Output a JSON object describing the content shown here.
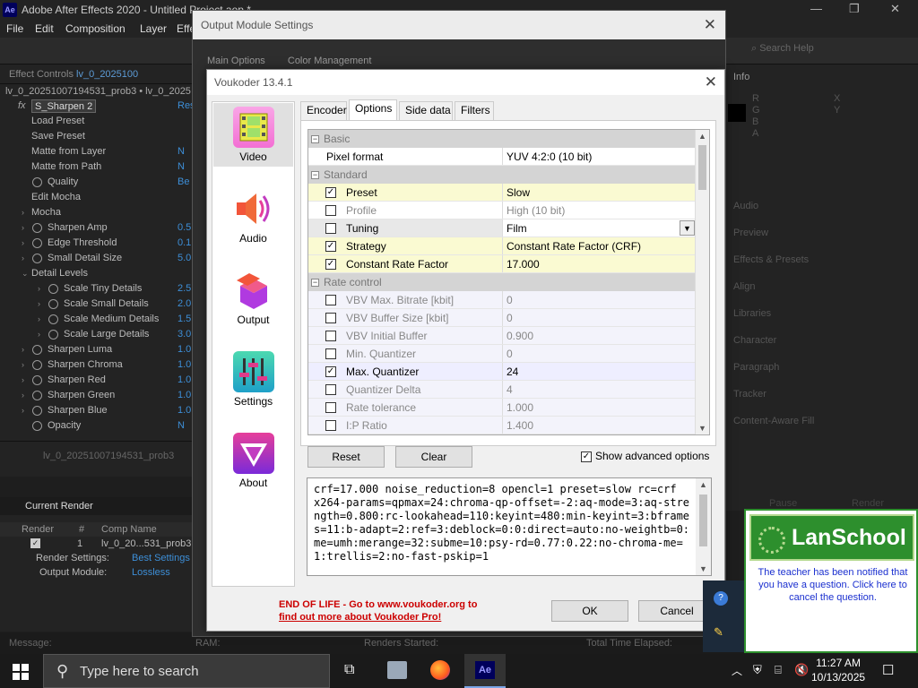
{
  "ae": {
    "title": "Adobe After Effects 2020 - Untitled Project.aep *",
    "logo": "Ae",
    "menu": [
      "File",
      "Edit",
      "Composition",
      "Layer",
      "Effe"
    ],
    "search_placeholder": "Search Help",
    "effect_controls_tab": "Effect Controls",
    "effect_controls_layer": "lv_0_2025100",
    "layer_path": "lv_0_20251007194531_prob3 • lv_0_2025",
    "effect_name": "S_Sharpen 2",
    "effect_reset": "Res",
    "fx_rows": [
      {
        "label": "Load Preset",
        "value": ""
      },
      {
        "label": "Save Preset",
        "value": ""
      },
      {
        "label": "Matte from Layer",
        "value": "N"
      },
      {
        "label": "Matte from Path",
        "value": "N"
      },
      {
        "label": "Quality",
        "value": "Be"
      },
      {
        "label": "Edit Mocha",
        "value": ""
      },
      {
        "label": "Mocha",
        "value": ""
      },
      {
        "label": "Sharpen Amp",
        "value": "0.5"
      },
      {
        "label": "Edge Threshold",
        "value": "0.1"
      },
      {
        "label": "Small Detail Size",
        "value": "5.0"
      },
      {
        "label": "Detail Levels",
        "value": ""
      },
      {
        "label": "Scale Tiny Details",
        "value": "2.5"
      },
      {
        "label": "Scale Small Details",
        "value": "2.0"
      },
      {
        "label": "Scale Medium Details",
        "value": "1.5"
      },
      {
        "label": "Scale Large Details",
        "value": "3.0"
      },
      {
        "label": "Sharpen Luma",
        "value": "1.0"
      },
      {
        "label": "Sharpen Chroma",
        "value": "1.0"
      },
      {
        "label": "Sharpen Red",
        "value": "1.0"
      },
      {
        "label": "Sharpen Green",
        "value": "1.0"
      },
      {
        "label": "Sharpen Blue",
        "value": "1.0"
      },
      {
        "label": "Opacity",
        "value": "N"
      }
    ],
    "project_item": "lv_0_20251007194531_prob3",
    "current_render": "Current Render",
    "render_cols": {
      "render": "Render",
      "num": "#",
      "comp": "Comp Name"
    },
    "render_item": {
      "num": "1",
      "comp": "lv_0_20...531_prob3"
    },
    "render_settings_label": "Render Settings:",
    "render_settings_value": "Best Settings",
    "output_module_label": "Output Module:",
    "output_module_value": "Lossless",
    "status": {
      "message": "Message:",
      "ram": "RAM:",
      "renders_started": "Renders Started:",
      "total_time": "Total Time Elapsed:"
    },
    "right_panel": [
      "Info",
      "Audio",
      "Preview",
      "Effects & Presets",
      "Align",
      "Libraries",
      "Character",
      "Paragraph",
      "Tracker",
      "Content-Aware Fill"
    ],
    "info_labels": {
      "r": "R",
      "g": "G",
      "b": "B",
      "a": "A",
      "x": "X",
      "y": "Y"
    },
    "right_buttons": {
      "render": "Render",
      "pause": "Pause"
    }
  },
  "output_module": {
    "title": "Output Module Settings",
    "tabs": [
      "Main Options",
      "Color Management"
    ]
  },
  "voukoder": {
    "title": "Voukoder 13.4.1",
    "sidebar": [
      "Video",
      "Audio",
      "Output",
      "Settings",
      "About"
    ],
    "tabs": [
      "Encoder",
      "Options",
      "Side data",
      "Filters"
    ],
    "sections": {
      "basic": "Basic",
      "standard": "Standard",
      "rate_control": "Rate control"
    },
    "basic_rows": [
      {
        "name": "Pixel format",
        "value": "YUV 4:2:0 (10 bit)"
      }
    ],
    "standard_rows": [
      {
        "name": "Preset",
        "value": "Slow",
        "checked": "✓"
      },
      {
        "name": "Profile",
        "value": "High (10 bit)",
        "checked": ""
      },
      {
        "name": "Tuning",
        "value": "Film",
        "checked": ""
      },
      {
        "name": "Strategy",
        "value": "Constant Rate Factor (CRF)",
        "checked": "✓"
      },
      {
        "name": "Constant Rate Factor",
        "value": "17.000",
        "checked": "✓"
      }
    ],
    "rate_rows": [
      {
        "name": "VBV Max. Bitrate [kbit]",
        "value": "0",
        "checked": ""
      },
      {
        "name": "VBV Buffer Size [kbit]",
        "value": "0",
        "checked": ""
      },
      {
        "name": "VBV Initial Buffer",
        "value": "0.900",
        "checked": ""
      },
      {
        "name": "Min. Quantizer",
        "value": "0",
        "checked": ""
      },
      {
        "name": "Max. Quantizer",
        "value": "24",
        "checked": "✓"
      },
      {
        "name": "Quantizer Delta",
        "value": "4",
        "checked": ""
      },
      {
        "name": "Rate tolerance",
        "value": "1.000",
        "checked": ""
      },
      {
        "name": "I:P Ratio",
        "value": "1.400",
        "checked": ""
      }
    ],
    "reset_label": "Reset",
    "clear_label": "Clear",
    "advanced_label": "Show advanced options",
    "advanced_checked": "✓",
    "command": "crf=17.000 noise_reduction=8 opencl=1 preset=slow rc=crf\nx264-params=qpmax=24:chroma-qp-offset=-2:aq-mode=3:aq-strength=0.800:rc-lookahead=110:keyint=480:min-keyint=3:bframes=11:b-adapt=2:ref=3:deblock=0:0:direct=auto:no-weightb=0:me=umh:merange=32:subme=10:psy-rd=0.77:0.22:no-chroma-me=1:trellis=2:no-fast-pskip=1",
    "eol_line1": "END OF LIFE - Go to www.voukoder.org to",
    "eol_line2": "find out more about Voukoder Pro!",
    "ok_label": "OK",
    "cancel_label": "Cancel"
  },
  "lanschool": {
    "brand": "LanSchool",
    "message": "The teacher has been notified that you have a question. Click here to cancel the question."
  },
  "taskbar": {
    "search_placeholder": "Type here to search",
    "time": "11:27 AM",
    "date": "10/13/2025"
  },
  "colors": {
    "ae_blue": "#3d8fd8",
    "lanschool_green": "#2d8f2d",
    "highlight": "#fafad2"
  }
}
